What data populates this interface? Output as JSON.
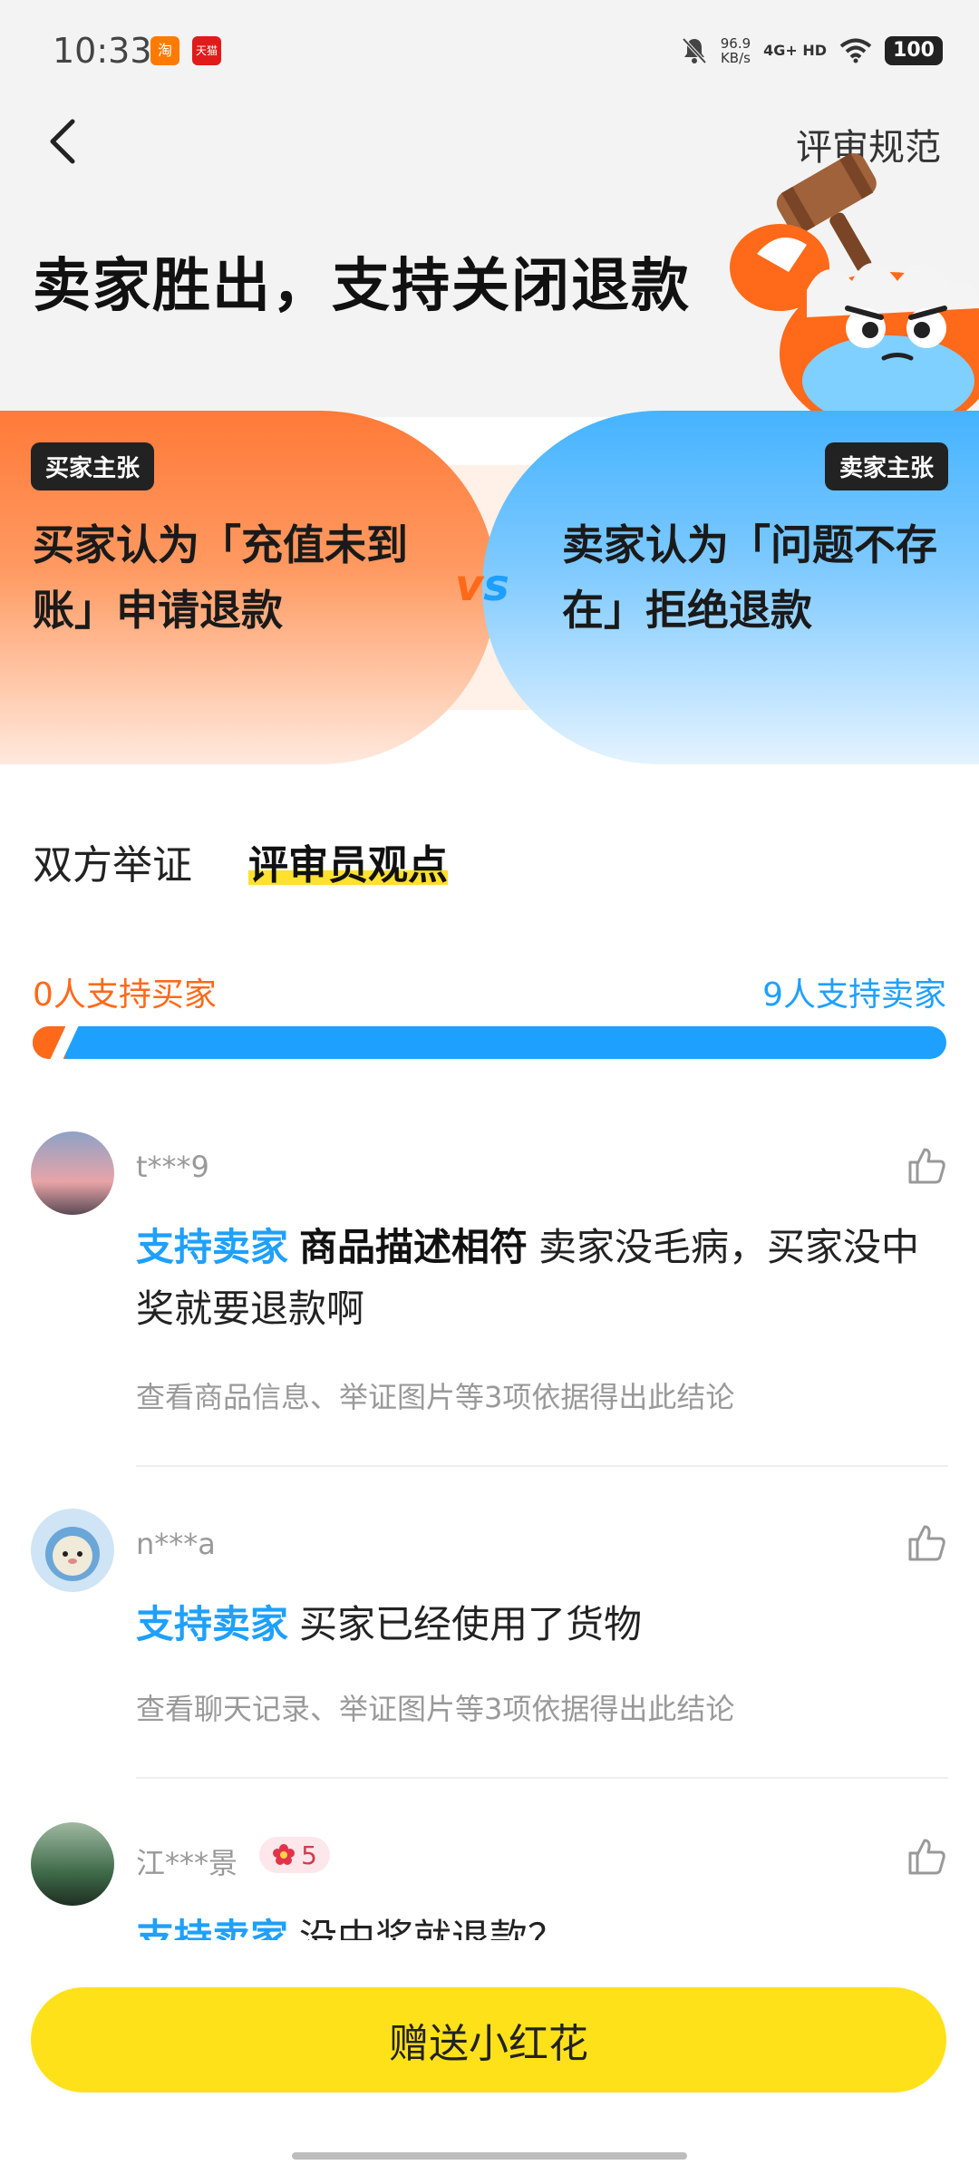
{
  "status_bar": {
    "time": "10:33",
    "app_icon_1": "淘",
    "app_icon_2": "天猫",
    "net_speed": "96.9",
    "net_speed_unit": "KB/s",
    "network": "4G+ HD",
    "battery": "100"
  },
  "header": {
    "back_icon": "chevron-left-icon",
    "rules_link": "评审规范",
    "title": "卖家胜出，支持关闭退款"
  },
  "dispute": {
    "buyer_tag": "买家主张",
    "buyer_claim": "买家认为「充值未到账」申请退款",
    "seller_tag": "卖家主张",
    "seller_claim": "卖家认为「问题不存在」拒绝退款",
    "vs_v": "v",
    "vs_s": "s"
  },
  "tabs": [
    {
      "label": "双方举证",
      "active": false
    },
    {
      "label": "评审员观点",
      "active": true
    }
  ],
  "support": {
    "buyer_label": "0人支持买家",
    "seller_label": "9人支持卖家",
    "buyer_count": 0,
    "seller_count": 9
  },
  "comments": [
    {
      "user": "t***9",
      "stance": "支持卖家",
      "reason": "商品描述相符",
      "text": "卖家没毛病，买家没中奖就要退款啊",
      "evidence": "查看商品信息、举证图片等3项依据得出此结论"
    },
    {
      "user": "n***a",
      "stance": "支持卖家",
      "reason": "",
      "text": "买家已经使用了货物",
      "evidence": "查看聊天记录、举证图片等3项依据得出此结论"
    },
    {
      "user": "江***景",
      "badge_count": "5",
      "stance": "支持卖家",
      "reason": "",
      "text": "没中奖就退款？",
      "evidence": ""
    }
  ],
  "footer": {
    "send_button": "赠送小红花"
  },
  "colors": {
    "buyer": "#ff6a1a",
    "seller": "#1ea0ff",
    "accent_yellow": "#ffe11a"
  }
}
